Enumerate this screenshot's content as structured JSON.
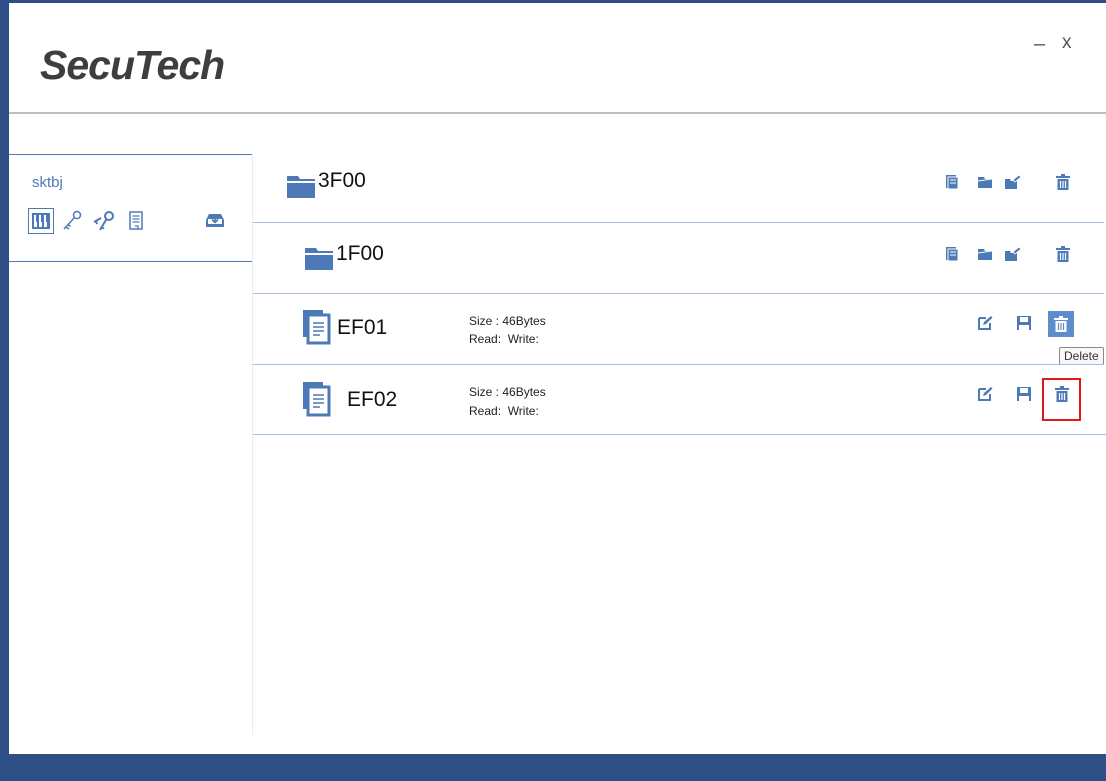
{
  "app": {
    "logo": "SecuTech",
    "minimize_symbol": "–",
    "close_symbol": "x"
  },
  "colors": {
    "accent": "#4e79b7",
    "frame": "#2d4f86",
    "highlight": "#e01a1a"
  },
  "sidebar": {
    "user": "sktbj",
    "tools": [
      {
        "icon": "piano-keys-icon",
        "active": true
      },
      {
        "icon": "key-icon",
        "active": false
      },
      {
        "icon": "keys-icon",
        "active": false
      },
      {
        "icon": "document-icon",
        "active": false
      },
      {
        "icon": "download-tray-icon",
        "active": false
      }
    ]
  },
  "tree": {
    "folders": [
      {
        "name": "3F00",
        "actions": [
          "add-file-icon",
          "add-folder-icon",
          "edit-folder-icon",
          "delete-icon"
        ]
      },
      {
        "name": "1F00",
        "actions": [
          "add-file-icon",
          "add-folder-icon",
          "edit-folder-icon",
          "delete-icon"
        ]
      }
    ],
    "files": [
      {
        "name": "EF01",
        "size": "Size : 46Bytes",
        "rw": "Read:  Write:",
        "actions": [
          "edit-icon",
          "save-icon",
          "delete-icon"
        ]
      },
      {
        "name": "EF02",
        "size": "Size : 46Bytes",
        "rw": "Read:  Write:",
        "actions": [
          "edit-icon",
          "save-icon",
          "delete-icon"
        ]
      }
    ]
  },
  "tooltip": {
    "text": "Delete"
  }
}
